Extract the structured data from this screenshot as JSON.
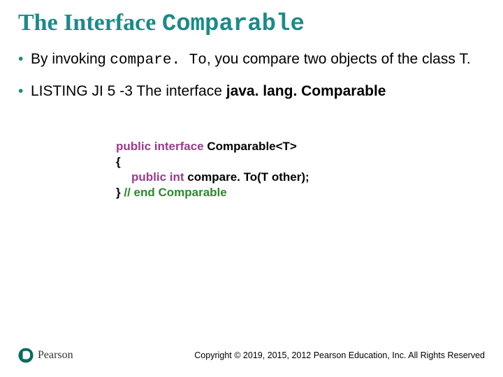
{
  "title": {
    "prefix": "The Interface ",
    "mono": "Comparable"
  },
  "bullets": {
    "b1": {
      "pre": "By invoking ",
      "mono": "compare. To",
      "post": ", you compare two objects of the class T."
    },
    "b2": {
      "pre": "LISTING JI 5 -3 The interface ",
      "bold": "java. lang. Comparable"
    }
  },
  "code": {
    "l1": {
      "kw": "public interface ",
      "name": "Comparable",
      "gen": "<T>"
    },
    "l2": "{",
    "l3": {
      "kw": "public int ",
      "name": "compare. To(T other);"
    },
    "l4": {
      "brace": "} ",
      "cmt": "// end Comparable"
    }
  },
  "brand": "Pearson",
  "copyright": "Copyright © 2019, 2015, 2012 Pearson Education, Inc. All Rights Reserved"
}
